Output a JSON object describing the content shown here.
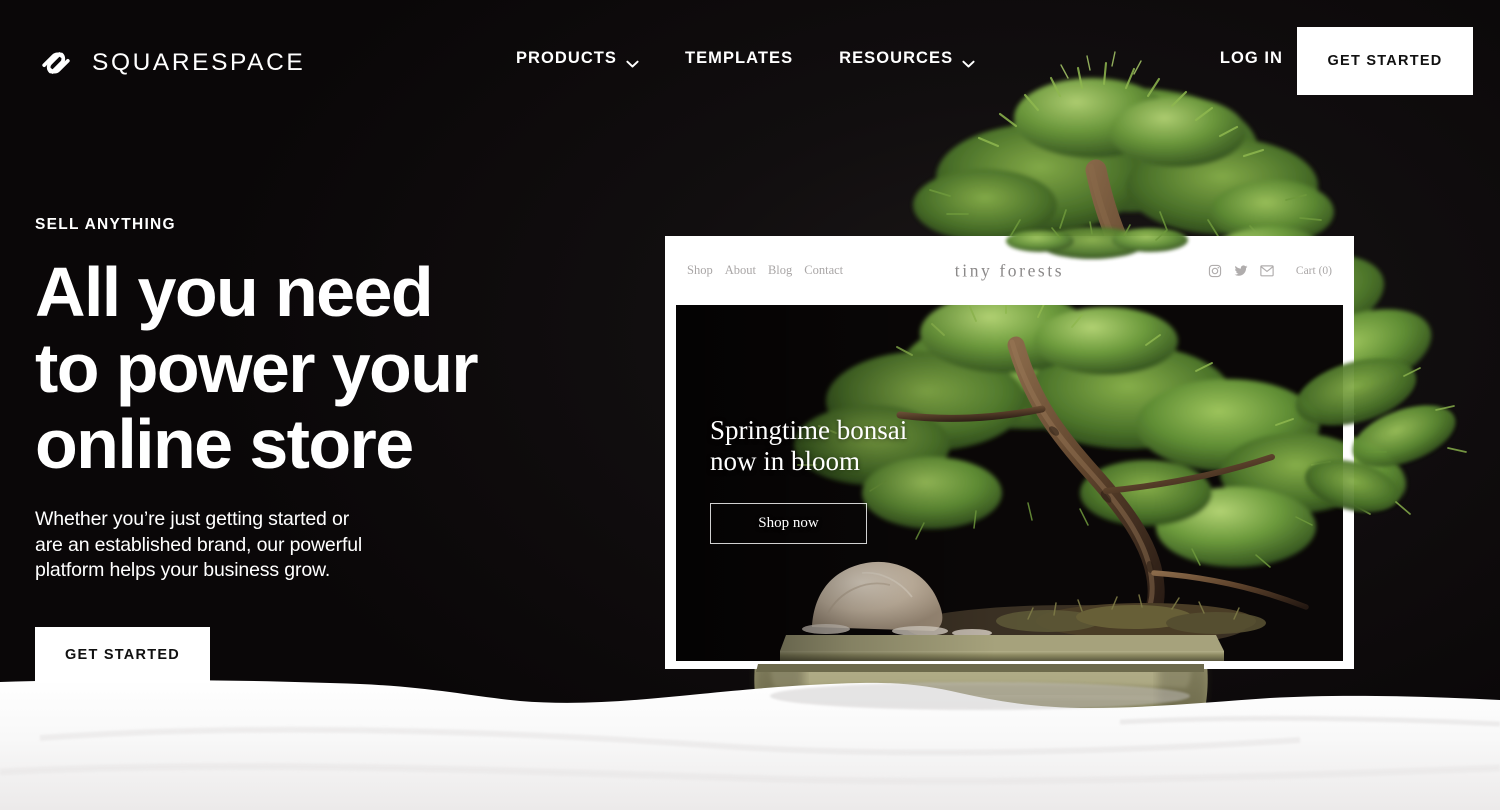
{
  "header": {
    "brand_name": "SQUARESPACE",
    "brand_icon": "squarespace-logo-icon",
    "nav": [
      {
        "label": "PRODUCTS",
        "has_chevron": true,
        "icon": "chevron-down-icon"
      },
      {
        "label": "TEMPLATES",
        "has_chevron": false,
        "icon": ""
      },
      {
        "label": "RESOURCES",
        "has_chevron": true,
        "icon": "chevron-down-icon"
      }
    ],
    "login_label": "LOG IN",
    "get_started_label": "GET STARTED"
  },
  "hero": {
    "eyebrow": "SELL ANYTHING",
    "headline_line1": "All you need",
    "headline_line2": "to power your",
    "headline_line3": "online store",
    "subcopy_line1": "Whether you’re just getting started or",
    "subcopy_line2": "are an established brand, our powerful",
    "subcopy_line3": "platform helps your business grow.",
    "cta_label": "GET STARTED"
  },
  "mockup": {
    "nav": [
      "Shop",
      "About",
      "Blog",
      "Contact"
    ],
    "logo": "tiny forests",
    "social_icons": [
      "instagram-icon",
      "twitter-icon",
      "email-icon"
    ],
    "cart_label": "Cart (0)",
    "hero_title_line1": "Springtime bonsai",
    "hero_title_line2": "now in bloom",
    "shop_now_label": "Shop now"
  },
  "colors": {
    "background": "#0b0809",
    "text_on_dark": "#ffffff",
    "button_bg": "#ffffff",
    "button_text": "#111111",
    "mockup_frame": "#ffffff",
    "mockup_muted_text": "#a9a6a6",
    "mockup_logo_text": "#8b8989",
    "sand": "#fbfbfb",
    "foliage_green": "#5d8a33",
    "pot_olive": "#8d8a62"
  }
}
